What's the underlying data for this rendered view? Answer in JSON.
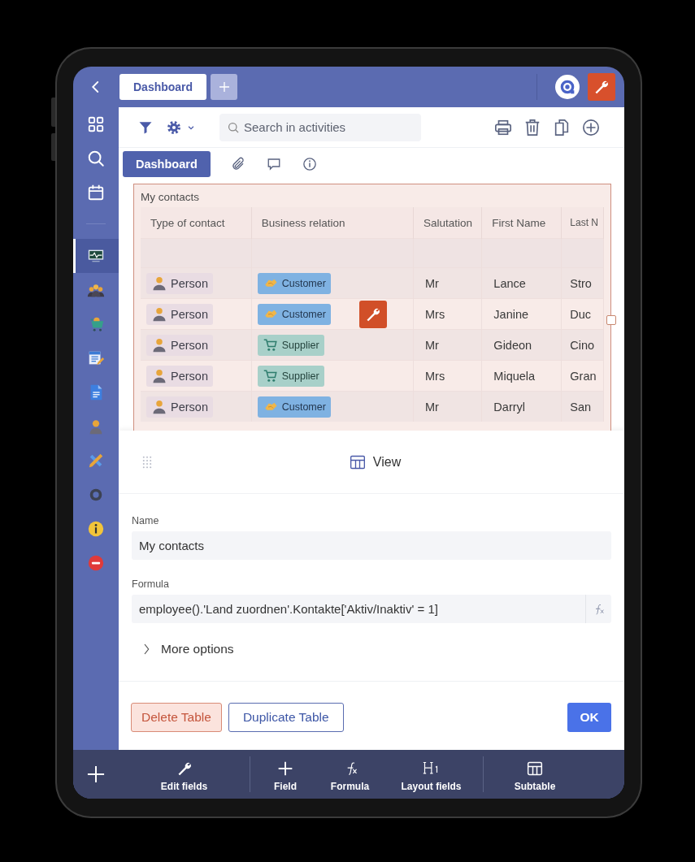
{
  "top_bar": {
    "tabs": [
      {
        "label": "Dashboard",
        "selected": true
      }
    ]
  },
  "sidebar": {
    "nav": [
      {
        "kind": "apps"
      },
      {
        "kind": "search"
      },
      {
        "kind": "calendar"
      }
    ],
    "modules": [
      {
        "kind": "monitor",
        "selected": true
      },
      {
        "kind": "people",
        "selected": false
      },
      {
        "kind": "cart",
        "selected": false
      },
      {
        "kind": "doc-edit",
        "selected": false
      },
      {
        "kind": "doc",
        "selected": false
      },
      {
        "kind": "person",
        "selected": false
      },
      {
        "kind": "tools",
        "selected": false
      },
      {
        "kind": "gear",
        "selected": false
      },
      {
        "kind": "info",
        "selected": false
      },
      {
        "kind": "minus",
        "selected": false
      }
    ]
  },
  "toolbar": {
    "search": {
      "placeholder": "Search in activities"
    }
  },
  "subtabs": [
    {
      "kind": "text",
      "label": "Dashboard",
      "selected": true
    },
    {
      "kind": "attachment",
      "selected": false
    },
    {
      "kind": "comment",
      "selected": false
    },
    {
      "kind": "info",
      "selected": false
    }
  ],
  "table": {
    "title": "My contacts",
    "columns": [
      "Type of contact",
      "Business relation",
      "Salutation",
      "First Name",
      "Last N"
    ],
    "rows": [
      {
        "kind": "customer",
        "cells": [
          "Person",
          "Customer",
          "Mr",
          "Lance",
          "Stro"
        ]
      },
      {
        "kind": "customer",
        "cells": [
          "Person",
          "Customer",
          "Mrs",
          "Janine",
          "Duc"
        ]
      },
      {
        "kind": "supplier",
        "cells": [
          "Person",
          "Supplier",
          "Mr",
          "Gideon",
          "Cino"
        ]
      },
      {
        "kind": "supplier",
        "cells": [
          "Person",
          "Supplier",
          "Mrs",
          "Miquela",
          "Gran"
        ]
      },
      {
        "kind": "customer",
        "cells": [
          "Person",
          "Customer",
          "Mr",
          "Darryl",
          "San"
        ]
      }
    ]
  },
  "panel": {
    "title": "View",
    "fields": [
      {
        "kind": "text",
        "label": "Name",
        "value": "My contacts"
      },
      {
        "kind": "formula",
        "label": "Formula",
        "value": "employee().'Land zuordnen'.Kontakte['Aktiv/Inaktiv' = 1]"
      }
    ],
    "more_options": {
      "label": "More options",
      "expanded": false
    },
    "buttons": [
      {
        "kind": "danger",
        "label": "Delete Table"
      },
      {
        "kind": "outline",
        "label": "Duplicate Table"
      },
      {
        "kind": "primary",
        "label": "OK"
      }
    ]
  },
  "bottom_bar": {
    "groups": [
      [
        {
          "kind": "wrench",
          "label": "Edit fields"
        }
      ],
      [
        {
          "kind": "plus",
          "label": "Field"
        },
        {
          "kind": "formula",
          "label": "Formula"
        },
        {
          "kind": "heading",
          "label": "Layout fields"
        }
      ],
      [
        {
          "kind": "subtable",
          "label": "Subtable"
        }
      ]
    ]
  }
}
